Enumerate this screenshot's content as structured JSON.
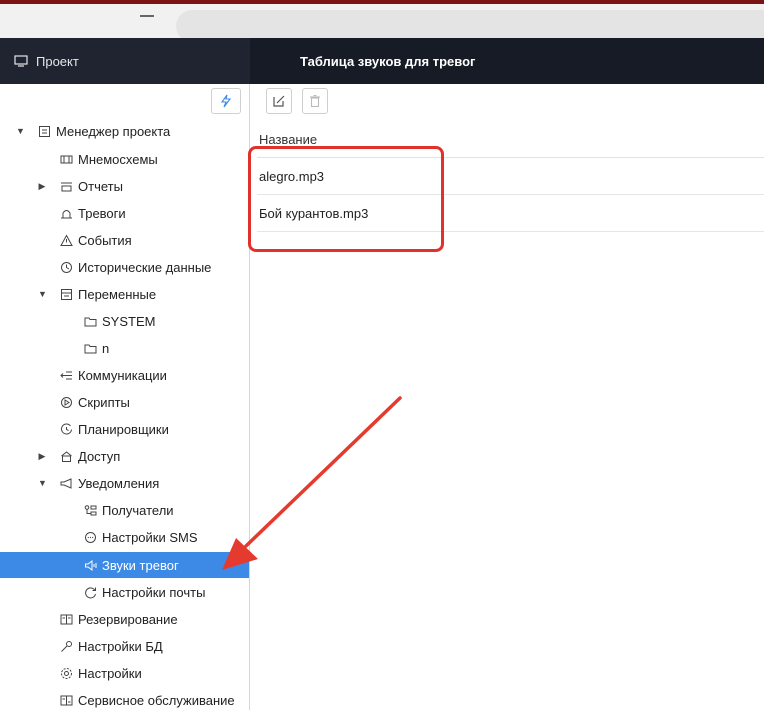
{
  "sidebar": {
    "title": "Проект",
    "items": [
      {
        "label": "Менеджер проекта",
        "icon": "list-doc-icon",
        "caret": "▼"
      },
      {
        "label": "Мнемосхемы",
        "icon": "mnemo-icon",
        "caret": ""
      },
      {
        "label": "Отчеты",
        "icon": "report-icon",
        "caret": "▶"
      },
      {
        "label": "Тревоги",
        "icon": "alarm-icon",
        "caret": ""
      },
      {
        "label": "События",
        "icon": "warning-icon",
        "caret": ""
      },
      {
        "label": "Исторические данные",
        "icon": "history-icon",
        "caret": ""
      },
      {
        "label": "Переменные",
        "icon": "variables-icon",
        "caret": "▼"
      },
      {
        "label": "SYSTEM",
        "icon": "folder-icon",
        "caret": ""
      },
      {
        "label": "n",
        "icon": "folder-icon",
        "caret": ""
      },
      {
        "label": "Коммуникации",
        "icon": "communications-icon",
        "caret": ""
      },
      {
        "label": "Скрипты",
        "icon": "script-icon",
        "caret": ""
      },
      {
        "label": "Планировщики",
        "icon": "scheduler-icon",
        "caret": ""
      },
      {
        "label": "Доступ",
        "icon": "access-icon",
        "caret": "▶"
      },
      {
        "label": "Уведомления",
        "icon": "notify-icon",
        "caret": "▼"
      },
      {
        "label": "Получатели",
        "icon": "recipients-icon",
        "caret": ""
      },
      {
        "label": "Настройки SMS",
        "icon": "sms-icon",
        "caret": ""
      },
      {
        "label": "Звуки тревог",
        "icon": "sound-icon",
        "caret": ""
      },
      {
        "label": "Настройки почты",
        "icon": "mail-settings-icon",
        "caret": ""
      },
      {
        "label": "Резервирование",
        "icon": "backup-icon",
        "caret": ""
      },
      {
        "label": "Настройки БД",
        "icon": "db-settings-icon",
        "caret": ""
      },
      {
        "label": "Настройки",
        "icon": "settings-icon",
        "caret": ""
      },
      {
        "label": "Сервисное обслуживание",
        "icon": "service-icon",
        "caret": ""
      }
    ]
  },
  "main": {
    "title": "Таблица звуков для тревог",
    "column_header": "Название",
    "rows": [
      "alegro.mp3",
      "Бой курантов.mp3"
    ]
  },
  "colors": {
    "sidebar_header_bg": "#1f2430",
    "main_header_bg": "#161b26",
    "selected_bg": "#3d8ae6",
    "annotation_red": "#e0322b"
  }
}
